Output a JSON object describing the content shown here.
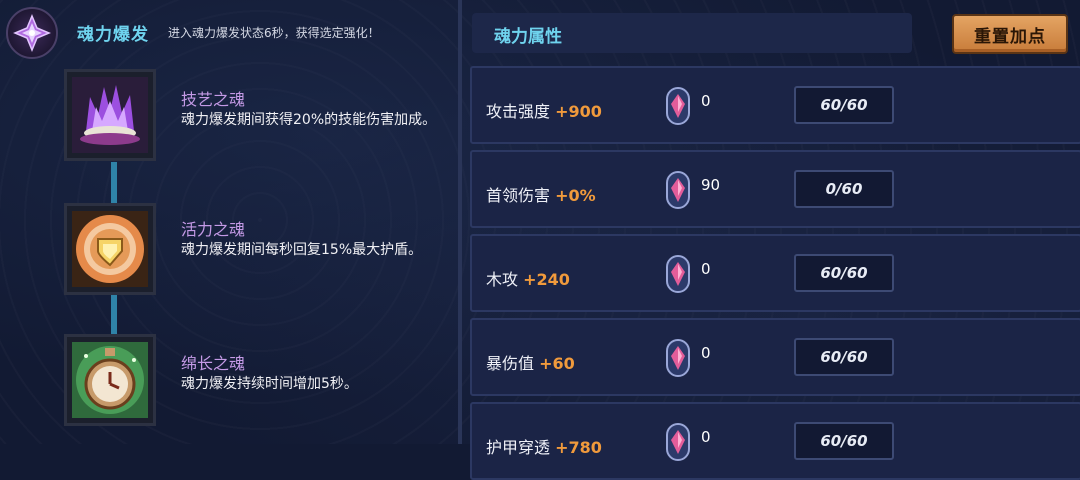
{
  "burst": {
    "title": "魂力爆发",
    "description": "进入魂力爆发状态6秒，获得选定强化！"
  },
  "skills": [
    {
      "name": "技艺之魂",
      "desc": "魂力爆发期间获得20%的技能伤害加成。",
      "icon": "purple-flame-crown-icon"
    },
    {
      "name": "活力之魂",
      "desc": "魂力爆发期间每秒回复15%最大护盾。",
      "icon": "golden-shield-badge-icon"
    },
    {
      "name": "绵长之魂",
      "desc": "魂力爆发持续时间增加5秒。",
      "icon": "stopwatch-icon"
    }
  ],
  "attributes": {
    "title": "魂力属性",
    "reset_label": "重置加点",
    "rows": [
      {
        "name": "攻击强度",
        "bonus": "+900",
        "gems": "0",
        "points": "60/60"
      },
      {
        "name": "首领伤害",
        "bonus": "+0%",
        "gems": "90",
        "points": "0/60"
      },
      {
        "name": "木攻",
        "bonus": "+240",
        "gems": "0",
        "points": "60/60"
      },
      {
        "name": "暴伤值",
        "bonus": "+60",
        "gems": "0",
        "points": "60/60"
      },
      {
        "name": "护甲穿透",
        "bonus": "+780",
        "gems": "0",
        "points": "60/60"
      }
    ]
  },
  "colors": {
    "title_cyan": "#6fd3ee",
    "bonus_orange": "#f09a3c",
    "skill_name_purple": "#c49ae6",
    "reset_button": "#d88f4e"
  }
}
